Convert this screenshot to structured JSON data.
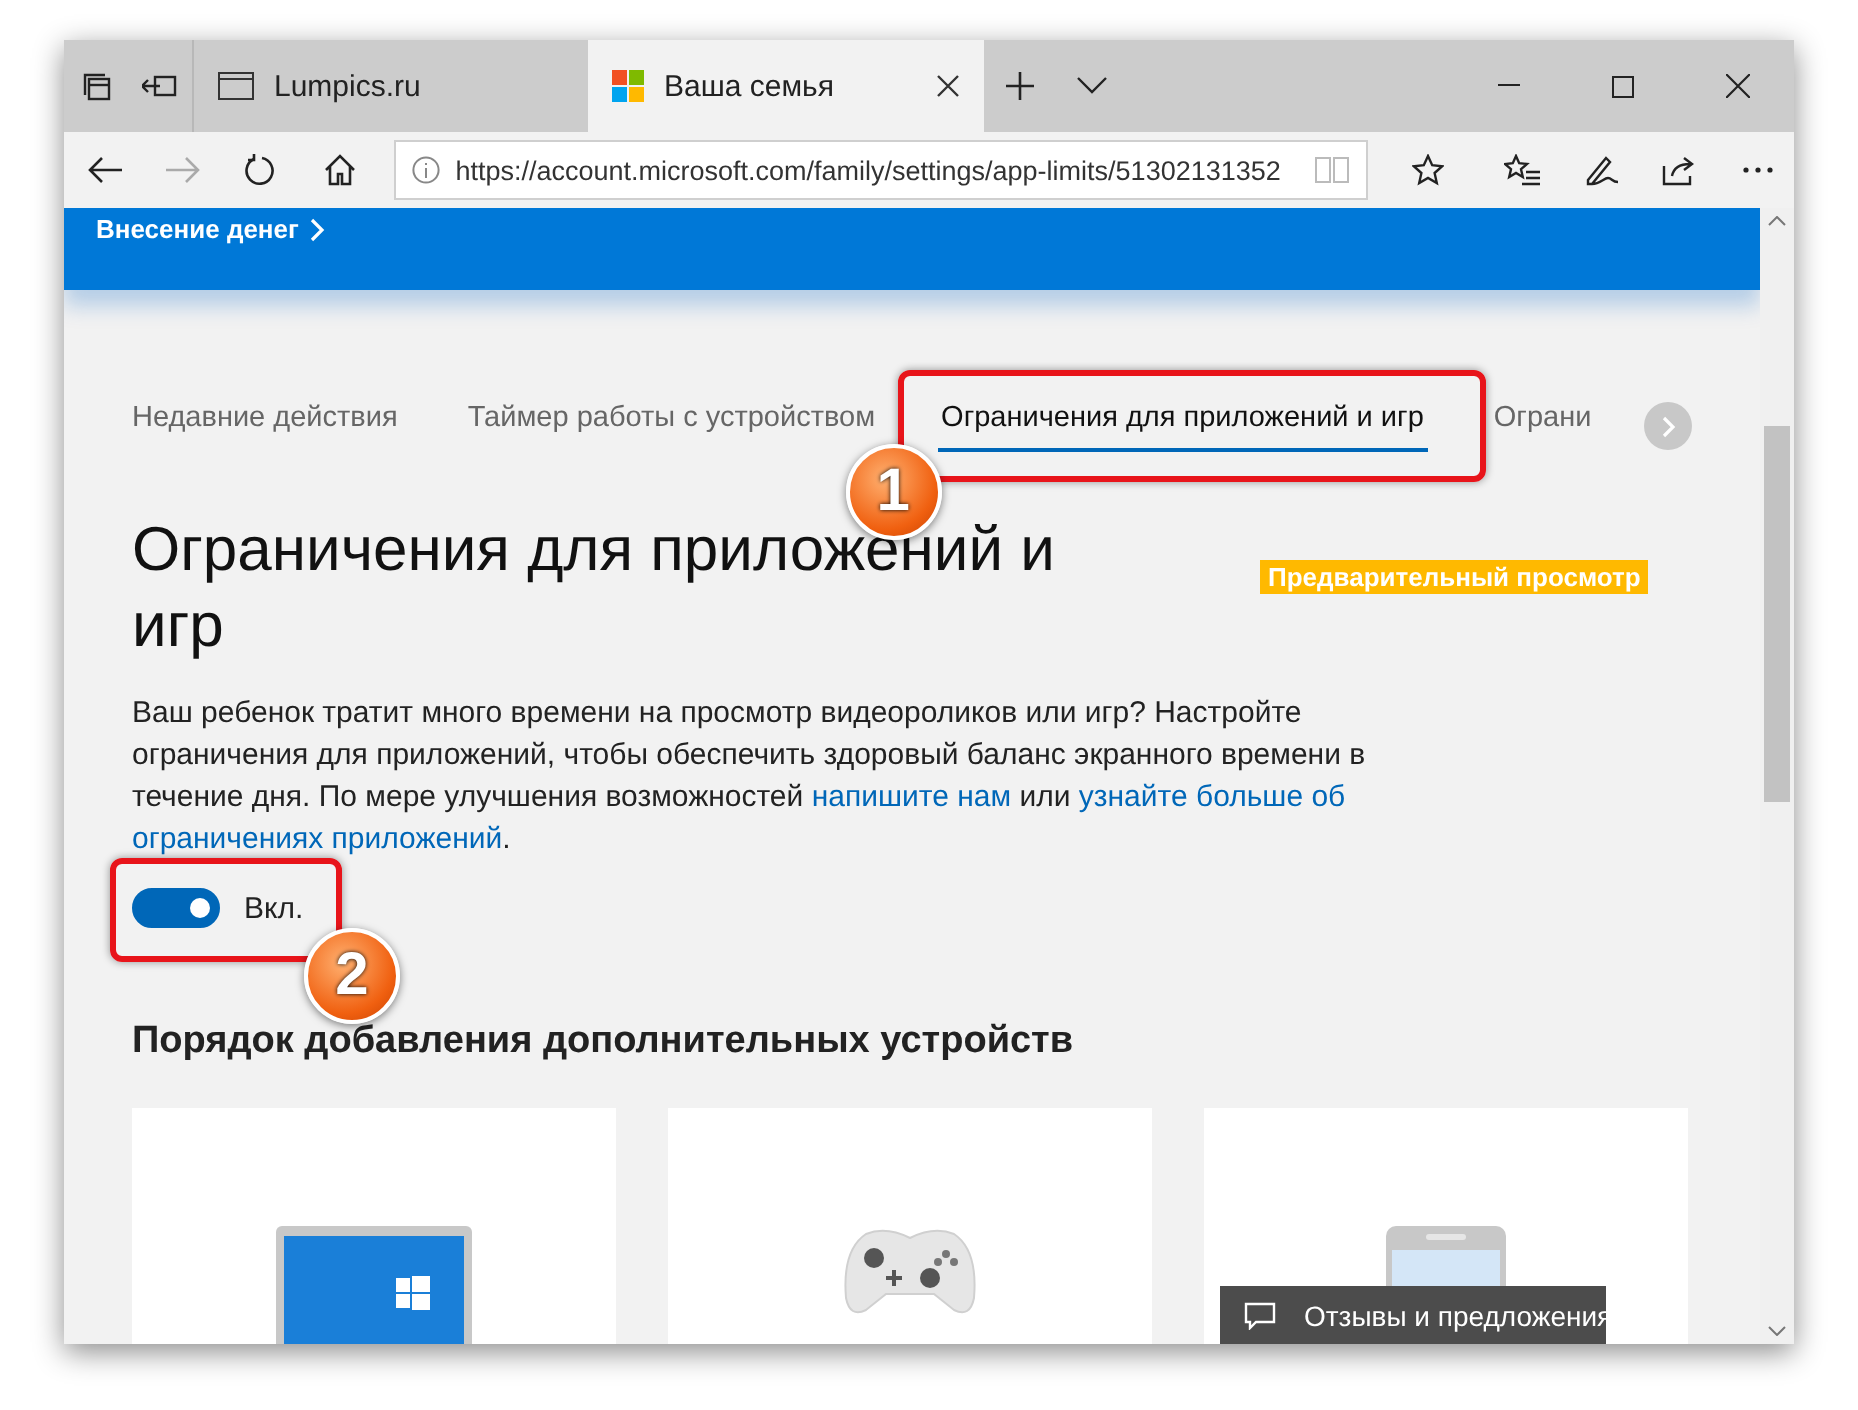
{
  "browser": {
    "tabs": [
      {
        "title": "Lumpics.ru",
        "selected": false,
        "kind": "page"
      },
      {
        "title": "Ваша семья",
        "selected": true,
        "kind": "microsoft"
      }
    ],
    "address": {
      "url": "https://account.microsoft.com/family/settings/app-limits/51302131352"
    }
  },
  "banner": {
    "link": "Внесение денег"
  },
  "page_tabs": [
    {
      "label": "Недавние действия",
      "selected": false
    },
    {
      "label": "Таймер работы с устройством",
      "selected": false
    },
    {
      "label": "Ограничения для приложений и игр",
      "selected": true
    },
    {
      "label": "Ограни",
      "selected": false
    }
  ],
  "annotations": [
    {
      "number": "1"
    },
    {
      "number": "2"
    }
  ],
  "heading": "Ограничения для приложений и игр",
  "badge": "Предварительный просмотр",
  "description": [
    {
      "kind": "text",
      "text": "Ваш ребенок тратит много времени на просмотр видеороликов или игр? Настройте ограничения для приложений, чтобы обеспечить здоровый баланс экранного времени в течение дня. По мере улучшения возможностей"
    },
    {
      "kind": "link",
      "text": "напишите нам"
    },
    {
      "kind": "text",
      "text": "или"
    },
    {
      "kind": "link",
      "text": "узнайте больше об"
    },
    {
      "kind": "link",
      "text": "ограничениях приложений"
    },
    {
      "kind": "text",
      "text": "."
    }
  ],
  "toggle": {
    "on": true,
    "label": "Вкл."
  },
  "section_heading": "Порядок добавления дополнительных устройств",
  "device_cards": [
    {
      "kind": "laptop"
    },
    {
      "kind": "console"
    },
    {
      "kind": "phone"
    }
  ],
  "feedback_button": "Отзывы и предложения"
}
